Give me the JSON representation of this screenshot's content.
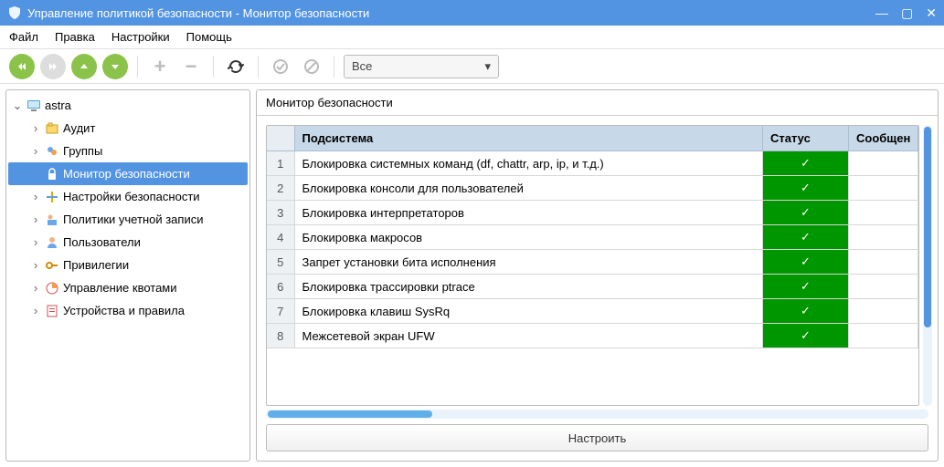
{
  "window": {
    "title": "Управление политикой безопасности - Монитор безопасности"
  },
  "menu": {
    "file": "Файл",
    "edit": "Правка",
    "settings": "Настройки",
    "help": "Помощь"
  },
  "toolbar": {
    "filter_selected": "Все"
  },
  "tree": {
    "root": "astra",
    "items": [
      {
        "label": "Аудит"
      },
      {
        "label": "Группы"
      },
      {
        "label": "Монитор безопасности",
        "selected": true
      },
      {
        "label": "Настройки безопасности"
      },
      {
        "label": "Политики учетной записи"
      },
      {
        "label": "Пользователи"
      },
      {
        "label": "Привилегии"
      },
      {
        "label": "Управление квотами"
      },
      {
        "label": "Устройства и правила"
      }
    ]
  },
  "panel": {
    "title": "Монитор безопасности",
    "columns": {
      "subsystem": "Подсистема",
      "status": "Статус",
      "message": "Сообщен"
    },
    "rows": [
      {
        "n": "1",
        "subsystem": "Блокировка системных команд (df, chattr, arp, ip, и т.д.)",
        "status": "✓"
      },
      {
        "n": "2",
        "subsystem": "Блокировка консоли для пользователей",
        "status": "✓"
      },
      {
        "n": "3",
        "subsystem": "Блокировка интерпретаторов",
        "status": "✓"
      },
      {
        "n": "4",
        "subsystem": "Блокировка макросов",
        "status": "✓"
      },
      {
        "n": "5",
        "subsystem": "Запрет установки бита исполнения",
        "status": "✓"
      },
      {
        "n": "6",
        "subsystem": "Блокировка трассировки ptrace",
        "status": "✓"
      },
      {
        "n": "7",
        "subsystem": "Блокировка клавиш SysRq",
        "status": "✓"
      },
      {
        "n": "8",
        "subsystem": "Межсетевой экран UFW",
        "status": "✓"
      }
    ],
    "configure": "Настроить"
  },
  "colors": {
    "accent": "#5294e2",
    "status_ok": "#009600"
  }
}
